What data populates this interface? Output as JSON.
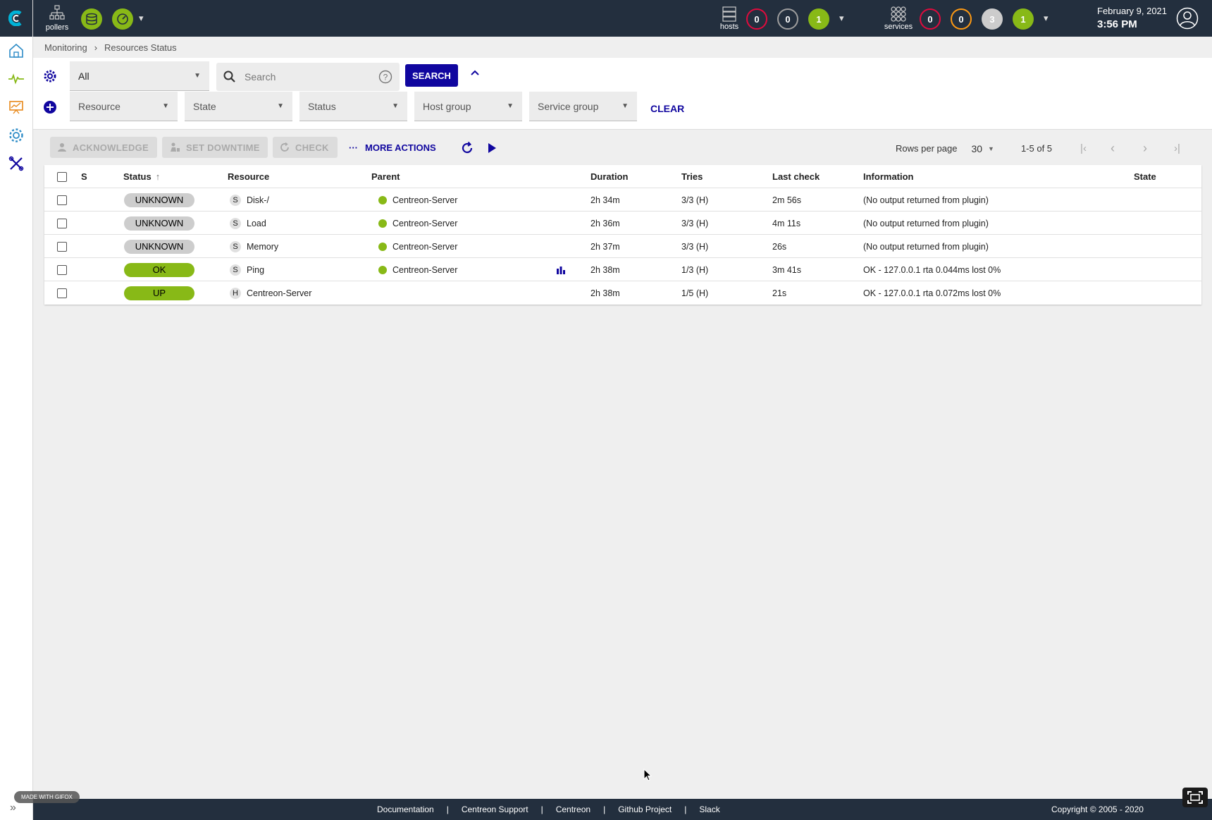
{
  "header": {
    "pollers_label": "pollers",
    "hosts_label": "hosts",
    "services_label": "services",
    "host_counts": [
      "0",
      "0",
      "1"
    ],
    "service_counts": [
      "0",
      "0",
      "3",
      "1"
    ],
    "date": "February 9, 2021",
    "time": "3:56 PM"
  },
  "breadcrumb": [
    "Monitoring",
    "Resources Status"
  ],
  "filters": {
    "saved_filter": "All",
    "search_placeholder": "Search",
    "search_button": "SEARCH",
    "criteria": [
      "Resource",
      "State",
      "Status",
      "Host group",
      "Service group"
    ],
    "clear_button": "CLEAR"
  },
  "actions": {
    "acknowledge": "ACKNOWLEDGE",
    "set_downtime": "SET DOWNTIME",
    "check": "CHECK",
    "more_actions": "MORE ACTIONS"
  },
  "pager": {
    "rows_per_page_label": "Rows per page",
    "rows_per_page_value": "30",
    "range": "1-5 of 5"
  },
  "table": {
    "columns": [
      "S",
      "Status",
      "Resource",
      "Parent",
      "Duration",
      "Tries",
      "Last check",
      "Information",
      "State"
    ],
    "rows": [
      {
        "status": "UNKNOWN",
        "status_kind": "unknown",
        "type": "S",
        "resource": "Disk-/",
        "parent": "Centreon-Server",
        "graph": false,
        "duration": "2h 34m",
        "tries": "3/3 (H)",
        "last_check": "2m 56s",
        "information": "(No output returned from plugin)"
      },
      {
        "status": "UNKNOWN",
        "status_kind": "unknown",
        "type": "S",
        "resource": "Load",
        "parent": "Centreon-Server",
        "graph": false,
        "duration": "2h 36m",
        "tries": "3/3 (H)",
        "last_check": "4m 11s",
        "information": "(No output returned from plugin)"
      },
      {
        "status": "UNKNOWN",
        "status_kind": "unknown",
        "type": "S",
        "resource": "Memory",
        "parent": "Centreon-Server",
        "graph": false,
        "duration": "2h 37m",
        "tries": "3/3 (H)",
        "last_check": "26s",
        "information": "(No output returned from plugin)"
      },
      {
        "status": "OK",
        "status_kind": "ok",
        "type": "S",
        "resource": "Ping",
        "parent": "Centreon-Server",
        "graph": true,
        "duration": "2h 38m",
        "tries": "1/3 (H)",
        "last_check": "3m 41s",
        "information": "OK - 127.0.0.1 rta 0.044ms lost 0%"
      },
      {
        "status": "UP",
        "status_kind": "up",
        "type": "H",
        "resource": "Centreon-Server",
        "parent": "",
        "graph": false,
        "duration": "2h 38m",
        "tries": "1/5 (H)",
        "last_check": "21s",
        "information": "OK - 127.0.0.1 rta 0.072ms lost 0%"
      }
    ]
  },
  "footer": {
    "links": [
      "Documentation",
      "Centreon Support",
      "Centreon",
      "Github Project",
      "Slack"
    ],
    "copyright": "Copyright © 2005 - 2020"
  },
  "watermark": "MADE WITH GIFOX",
  "colors": {
    "header_bg": "#232f3e",
    "brand_blue": "#10069f",
    "ok_green": "#88b917",
    "unknown_grey": "#cdcdcd",
    "critical_red": "#e00b3d",
    "warning_orange": "#ff9a13"
  }
}
